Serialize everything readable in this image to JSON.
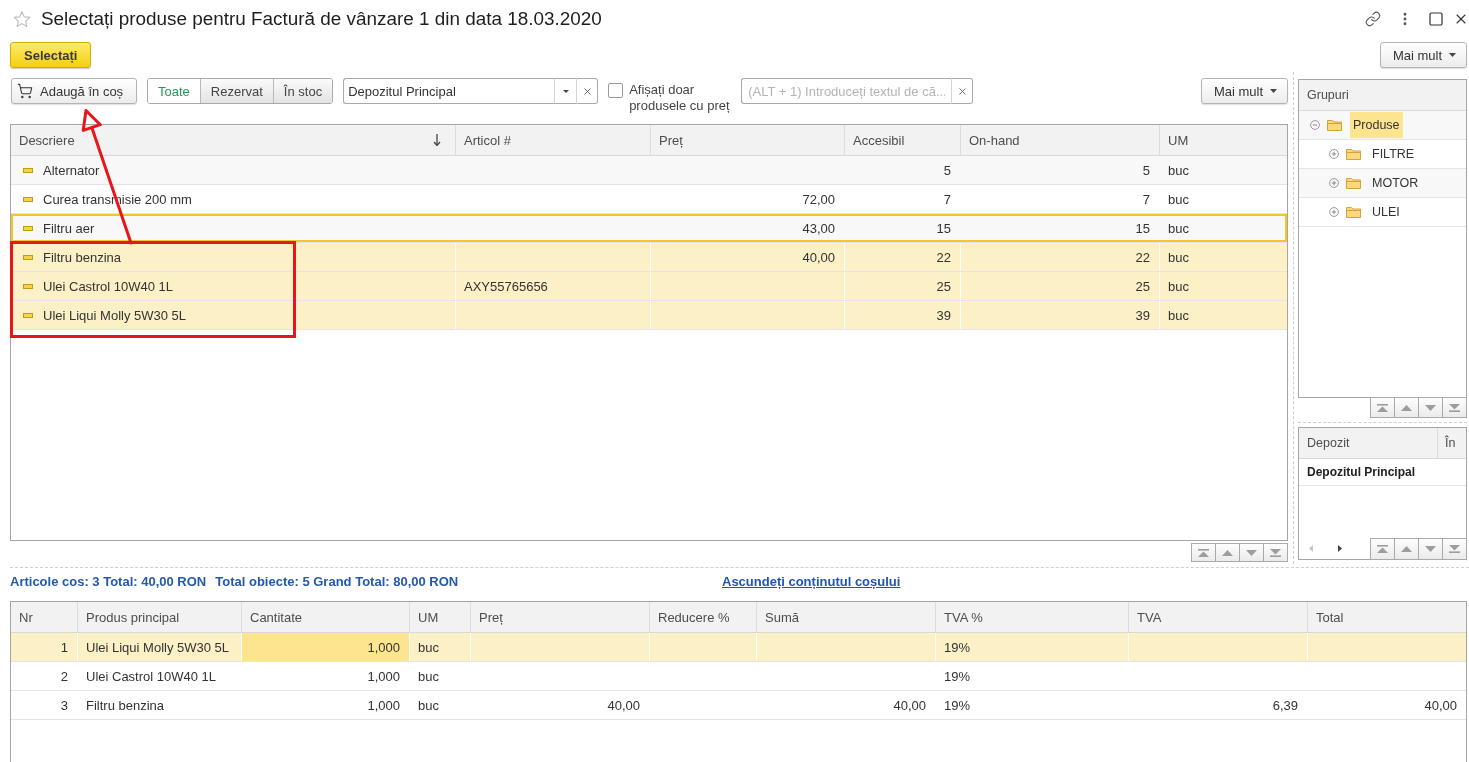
{
  "window": {
    "title": "Selectați produse pentru Factură de vânzare 1 din data 18.03.2020",
    "favorite": false
  },
  "command_bar": {
    "select_button": "Selectați",
    "more_button": "Mai mult"
  },
  "filter_bar": {
    "add_to_cart_button": "Adaugă în coș",
    "stock_tabs": [
      {
        "label": "Toate",
        "selected": true
      },
      {
        "label": "Rezervat",
        "selected": false
      },
      {
        "label": "În stoc",
        "selected": false
      }
    ],
    "warehouse_field": {
      "value": "Depozitul Principal"
    },
    "price_only_checkbox": {
      "label": "Afișați doar produsele cu preț",
      "checked": false
    },
    "search_field": {
      "placeholder": "(ALT + 1) Introduceți textul de că..."
    },
    "more_button": "Mai mult"
  },
  "products_table": {
    "columns": [
      {
        "label": "Descriere",
        "sorted": true
      },
      {
        "label": "Articol #",
        "sorted": false
      },
      {
        "label": "Preț",
        "sorted": false
      },
      {
        "label": "Accesibil",
        "sorted": false
      },
      {
        "label": "On-hand",
        "sorted": false
      },
      {
        "label": "UM",
        "sorted": false
      }
    ],
    "rows": [
      {
        "description": "Alternator",
        "available": "5",
        "on_hand": "5",
        "unit": "buc",
        "selected": false,
        "current": false
      },
      {
        "description": "Curea transmisie 200 mm",
        "price": "72,00",
        "available": "7",
        "on_hand": "7",
        "unit": "buc",
        "selected": false,
        "current": false
      },
      {
        "description": "Filtru aer",
        "price": "43,00",
        "available": "15",
        "on_hand": "15",
        "unit": "buc",
        "selected": false,
        "current": true
      },
      {
        "description": "Filtru benzina",
        "price": "40,00",
        "available": "22",
        "on_hand": "22",
        "unit": "buc",
        "selected": true,
        "current": false
      },
      {
        "description": "Ulei Castrol 10W40 1L",
        "article": "AXY55765656",
        "available": "25",
        "on_hand": "25",
        "unit": "buc",
        "selected": true,
        "current": false
      },
      {
        "description": "Ulei Liqui Molly 5W30 5L",
        "available": "39",
        "on_hand": "39",
        "unit": "buc",
        "selected": true,
        "current": false
      }
    ]
  },
  "groups_panel": {
    "title": "Grupuri",
    "tree": [
      {
        "label": "Produse",
        "expanded": true,
        "selected": true,
        "children": [
          {
            "label": "FILTRE",
            "expanded": false,
            "selected": false
          },
          {
            "label": "MOTOR",
            "expanded": false,
            "selected": false
          },
          {
            "label": "ULEI",
            "expanded": false,
            "selected": false
          }
        ]
      }
    ]
  },
  "warehouse_panel": {
    "columns": [
      "Depozit",
      "În"
    ],
    "rows": [
      {
        "name": "Depozitul Principal"
      }
    ]
  },
  "cart_summary": {
    "items": [
      "Articole cos: 3 Total: 40,00 RON",
      "Total obiecte: 5 Grand Total: 80,00 RON"
    ],
    "toggle_link": "Ascundeți conținutul coșului"
  },
  "cart_table": {
    "columns": [
      "Nr",
      "Produs principal",
      "Cantitate",
      "UM",
      "Preț",
      "Reducere %",
      "Sumă",
      "TVA %",
      "TVA",
      "Total"
    ],
    "rows": [
      {
        "nr": "1",
        "product": "Ulei Liqui Molly 5W30 5L",
        "quantity": "1,000",
        "unit": "buc",
        "vat_rate": "19%",
        "selected": true,
        "quantity_focused": true
      },
      {
        "nr": "2",
        "product": "Ulei Castrol 10W40 1L",
        "quantity": "1,000",
        "unit": "buc",
        "vat_rate": "19%",
        "selected": false,
        "quantity_focused": false
      },
      {
        "nr": "3",
        "product": "Filtru benzina",
        "quantity": "1,000",
        "unit": "buc",
        "price": "40,00",
        "amount": "40,00",
        "vat_rate": "19%",
        "vat": "6,39",
        "total": "40,00",
        "selected": false,
        "quantity_focused": false
      }
    ]
  }
}
